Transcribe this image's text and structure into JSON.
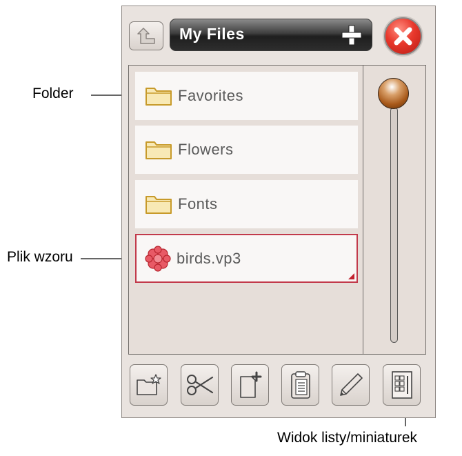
{
  "window": {
    "title": "My Files"
  },
  "files": [
    {
      "label": "Favorites",
      "type": "folder"
    },
    {
      "label": "Flowers",
      "type": "folder"
    },
    {
      "label": "Fonts",
      "type": "folder"
    },
    {
      "label": "birds.vp3",
      "type": "design",
      "selected": true
    }
  ],
  "annotations": {
    "folder": "Folder",
    "design_file": "Plik wzoru",
    "view_toggle": "Widok listy/miniaturek"
  },
  "toolbar": {
    "icons": [
      "new-folder-icon",
      "scissors-icon",
      "new-file-icon",
      "clipboard-icon",
      "pencil-icon",
      "list-thumbnail-view-icon"
    ]
  },
  "colors": {
    "panel_bg": "#e9e3df",
    "accent_red": "#c23a4b",
    "folder_yellow": "#e0b94a",
    "title_bar_dark": "#2e2e2e"
  }
}
